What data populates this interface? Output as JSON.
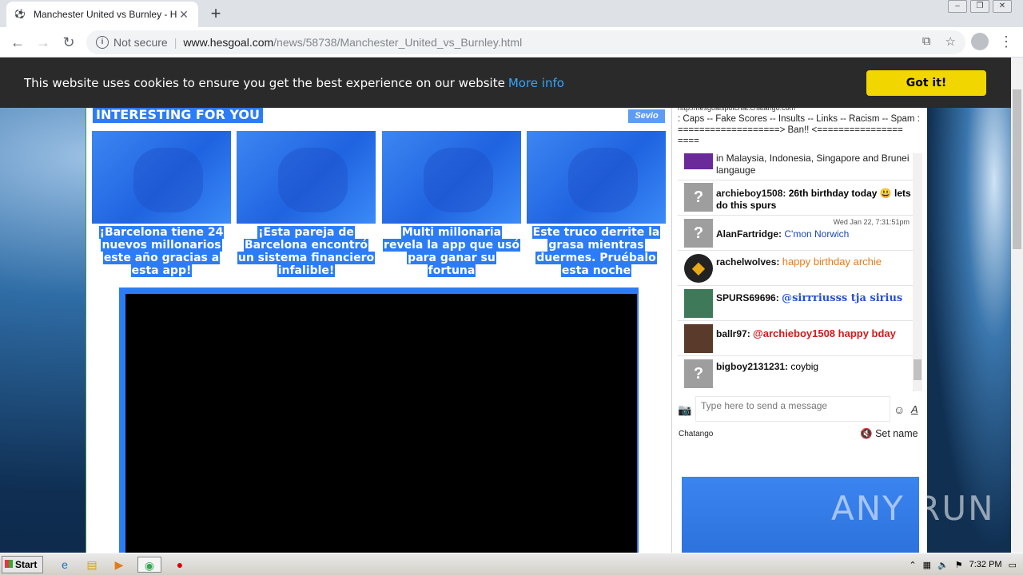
{
  "browser": {
    "tab_title": "Manchester United vs Burnley - Hes…",
    "omnibox_status": "Not secure",
    "url_host": "www.hesgoal.com",
    "url_path": "/news/58738/Manchester_United_vs_Burnley.html"
  },
  "cookie_banner": {
    "text": "This website uses cookies to ensure you get the best experience on our website",
    "more_link": "More info",
    "accept_label": "Got it!",
    "accept_color": "#f1d600"
  },
  "recommendations": {
    "title": "INTERESTING FOR YOU",
    "provider_logo": "Sevio",
    "cards": [
      {
        "caption": "¡Barcelona tiene 24 nuevos millonarios este año gracias a esta app!"
      },
      {
        "caption": "¡Esta pareja de Barcelona encontró un sistema financiero infalible!"
      },
      {
        "caption": "Multi millonaria revela la app que usó para ganar su fortuna"
      },
      {
        "caption": "Este truco derrite la grasa mientras duermes. Pruébalo esta noche"
      }
    ]
  },
  "chat": {
    "rules_url": "http://hesgoalspotchat.chatango.com",
    "rules_text": ": Caps -- Fake Scores -- Insults -- Links -- Racism -- Spam : ===================> Ban!! <================ ====",
    "messages": [
      {
        "user": "",
        "text": "in Malaysia, Indonesia, Singapore and Brunei langauge",
        "text_color": "#222222",
        "timestamp": ""
      },
      {
        "user": "archieboy1508:",
        "text": "26th birthday today 😃 lets do this spurs",
        "text_color": "#111111",
        "timestamp": ""
      },
      {
        "user": "AlanFartridge:",
        "text": "C'mon Norwich",
        "text_color": "#1a4aa8",
        "timestamp": "Wed Jan 22, 7:31:51pm"
      },
      {
        "user": "rachelwolves:",
        "text": "happy birthday archie",
        "text_color": "#e87a1c",
        "timestamp": ""
      },
      {
        "user": "SPURS69696:",
        "text": "@sirrriusss tja sirius",
        "text_color": "#2a4fd0",
        "timestamp": ""
      },
      {
        "user": "ballr97:",
        "text": "@archieboy1508 happy bday",
        "text_color": "#d21a1a",
        "timestamp": ""
      },
      {
        "user": "bigboy2131231:",
        "text": "coybig",
        "text_color": "#111111",
        "timestamp": ""
      }
    ],
    "input_placeholder": "Type here to send a message",
    "brand": "Chatango",
    "set_name": "Set name"
  },
  "watermark": "ANY RUN",
  "taskbar": {
    "start_label": "Start",
    "clock": "7:32 PM"
  }
}
